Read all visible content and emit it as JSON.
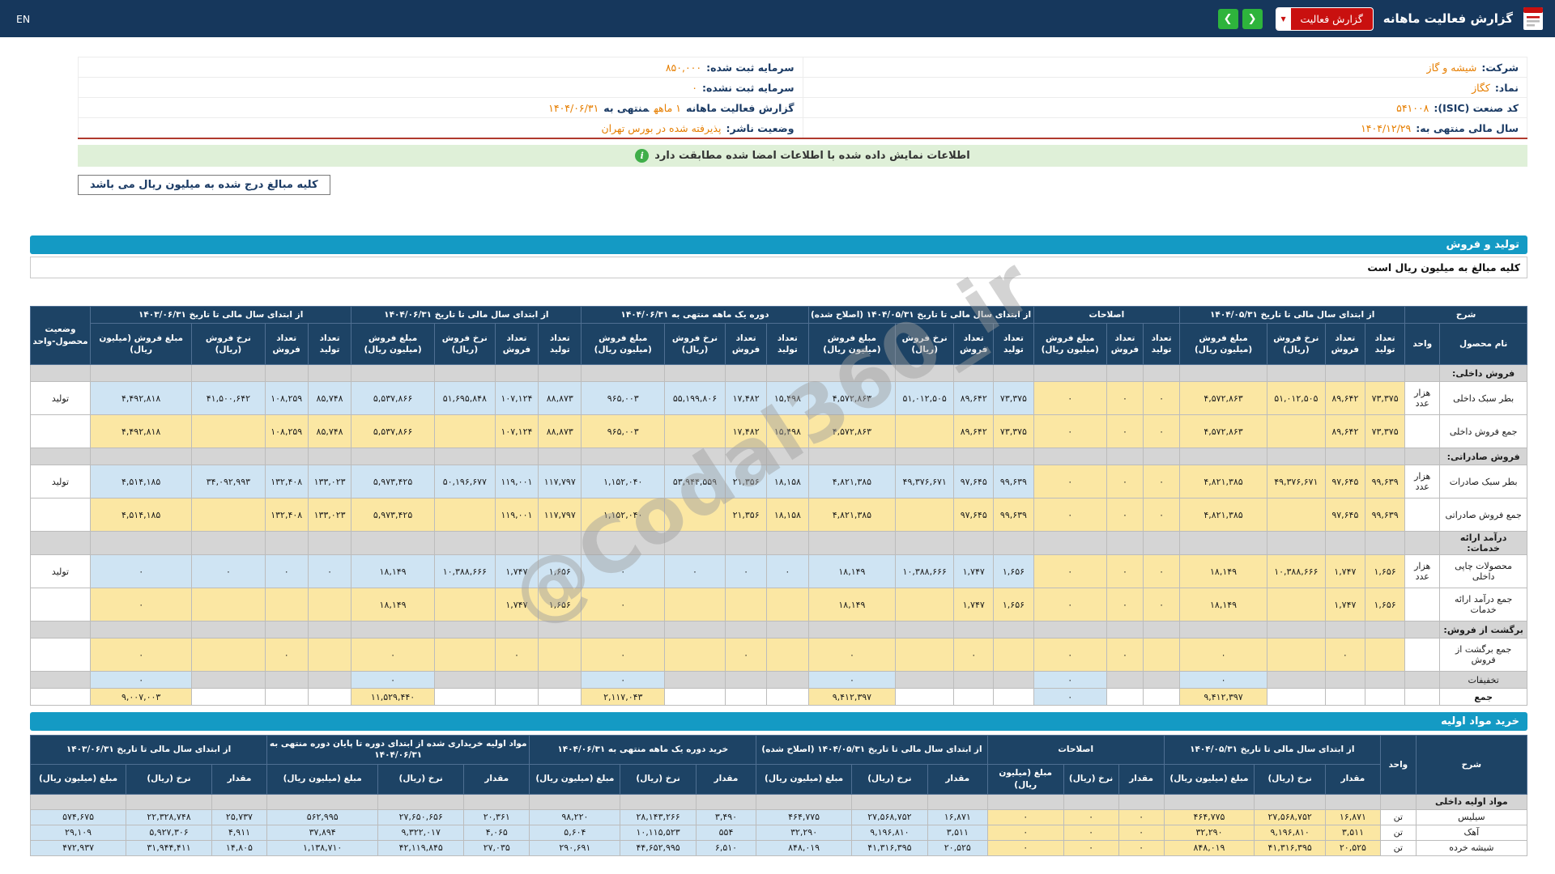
{
  "topbar": {
    "title": "گزارش فعالیت ماهانه",
    "report_button": "گزارش فعالیت",
    "caret": "▼",
    "nav_prev": "❮",
    "nav_next": "❯",
    "lang": "EN"
  },
  "info": {
    "rows": [
      {
        "r_label": "شرکت:",
        "r_value": "شیشه و گاز",
        "l_label": "سرمایه ثبت شده:",
        "l_value": "۸۵۰,۰۰۰"
      },
      {
        "r_label": "نماد:",
        "r_value": "کگاز",
        "l_label": "سرمایه ثبت نشده:",
        "l_value": "۰"
      },
      {
        "r_label": "کد صنعت (ISIC):",
        "r_value": "۵۴۱۰۰۸",
        "l_label": "گزارش فعالیت ماهانه",
        "l_value": "۱ ماهه",
        "l_mid": "منتهی به",
        "l_date": "۱۴۰۴/۰۶/۳۱"
      },
      {
        "r_label": "سال مالی منتهی به:",
        "r_value": "۱۴۰۴/۱۲/۲۹",
        "l_label": "وضعیت ناشر:",
        "l_value": "پذیرفته شده در بورس تهران"
      }
    ]
  },
  "alert": {
    "text": "اطلاعات نمایش داده شده با اطلاعات امضا شده مطابقت دارد",
    "icon_glyph": "i"
  },
  "note_box": "کلیه مبالغ درج شده به میلیون ریال می باشد",
  "watermark": "@Codal360_ir",
  "production_section": {
    "title": "تولید و فروش",
    "subtitle": "کلیه مبالغ به میلیون ریال است"
  },
  "production_table": {
    "desc_header": "شرح",
    "product_header": "نام محصول",
    "unit_header": "واحد",
    "status_header": "وضعیت محصول-واحد",
    "groups": [
      {
        "title": "از ابتدای سال مالی تا تاریخ ۱۴۰۴/۰۵/۳۱",
        "cols": [
          "تعداد تولید",
          "تعداد فروش",
          "نرخ فروش (ریال)",
          "مبلغ فروش (میلیون ریال)"
        ]
      },
      {
        "title": "اصلاحات",
        "cols": [
          "تعداد تولید",
          "تعداد فروش",
          "مبلغ فروش (میلیون ریال)"
        ]
      },
      {
        "title": "از ابتدای سال مالی تا تاریخ ۱۴۰۴/۰۵/۳۱ (اصلاح شده)",
        "cols": [
          "تعداد تولید",
          "تعداد فروش",
          "نرخ فروش (ریال)",
          "مبلغ فروش (میلیون ریال)"
        ]
      },
      {
        "title": "دوره یک ماهه منتهی به ۱۴۰۴/۰۶/۳۱",
        "cols": [
          "تعداد تولید",
          "تعداد فروش",
          "نرخ فروش (ریال)",
          "مبلغ فروش (میلیون ریال)"
        ]
      },
      {
        "title": "از ابتدای سال مالی تا تاریخ ۱۴۰۴/۰۶/۳۱",
        "cols": [
          "تعداد تولید",
          "تعداد فروش",
          "نرخ فروش (ریال)",
          "مبلغ فروش (میلیون ریال)"
        ]
      },
      {
        "title": "از ابتدای سال مالی تا تاریخ ۱۴۰۳/۰۶/۳۱",
        "cols": [
          "تعداد تولید",
          "تعداد فروش",
          "نرخ فروش (ریال)",
          "مبلغ فروش (میلیون ریال)"
        ]
      }
    ],
    "rows": [
      {
        "type": "section",
        "name": "فروش داخلی:"
      },
      {
        "type": "product",
        "name": "بطر سبک داخلی",
        "unit": "هزار عدد",
        "status": "تولید",
        "cells": [
          "۷۳,۳۷۵",
          "۸۹,۶۴۲",
          "۵۱,۰۱۲,۵۰۵",
          "۴,۵۷۲,۸۶۳",
          "۰",
          "۰",
          "۰",
          "۷۳,۳۷۵",
          "۸۹,۶۴۲",
          "۵۱,۰۱۲,۵۰۵",
          "۴,۵۷۲,۸۶۳",
          "۱۵,۴۹۸",
          "۱۷,۴۸۲",
          "۵۵,۱۹۹,۸۰۶",
          "۹۶۵,۰۰۳",
          "۸۸,۸۷۳",
          "۱۰۷,۱۲۴",
          "۵۱,۶۹۵,۸۴۸",
          "۵,۵۳۷,۸۶۶",
          "۸۵,۷۴۸",
          "۱۰۸,۲۵۹",
          "۴۱,۵۰۰,۶۴۲",
          "۴,۴۹۲,۸۱۸"
        ]
      },
      {
        "type": "sum",
        "name": "جمع فروش داخلی",
        "cells": [
          "۷۳,۳۷۵",
          "۸۹,۶۴۲",
          "",
          "۴,۵۷۲,۸۶۳",
          "۰",
          "۰",
          "۰",
          "۷۳,۳۷۵",
          "۸۹,۶۴۲",
          "",
          "۴,۵۷۲,۸۶۳",
          "۱۵,۴۹۸",
          "۱۷,۴۸۲",
          "",
          "۹۶۵,۰۰۳",
          "۸۸,۸۷۳",
          "۱۰۷,۱۲۴",
          "",
          "۵,۵۳۷,۸۶۶",
          "۸۵,۷۴۸",
          "۱۰۸,۲۵۹",
          "",
          "۴,۴۹۲,۸۱۸"
        ]
      },
      {
        "type": "section",
        "name": "فروش صادراتی:"
      },
      {
        "type": "product",
        "name": "بطر سبک صادرات",
        "unit": "هزار عدد",
        "status": "تولید",
        "cells": [
          "۹۹,۶۳۹",
          "۹۷,۶۴۵",
          "۴۹,۳۷۶,۶۷۱",
          "۴,۸۲۱,۳۸۵",
          "۰",
          "۰",
          "۰",
          "۹۹,۶۳۹",
          "۹۷,۶۴۵",
          "۴۹,۳۷۶,۶۷۱",
          "۴,۸۲۱,۳۸۵",
          "۱۸,۱۵۸",
          "۲۱,۳۵۶",
          "۵۳,۹۴۴,۵۵۹",
          "۱,۱۵۲,۰۴۰",
          "۱۱۷,۷۹۷",
          "۱۱۹,۰۰۱",
          "۵۰,۱۹۶,۶۷۷",
          "۵,۹۷۳,۴۲۵",
          "۱۳۳,۰۲۳",
          "۱۳۲,۴۰۸",
          "۳۴,۰۹۲,۹۹۳",
          "۴,۵۱۴,۱۸۵"
        ]
      },
      {
        "type": "sum",
        "name": "جمع فروش صادراتی",
        "cells": [
          "۹۹,۶۳۹",
          "۹۷,۶۴۵",
          "",
          "۴,۸۲۱,۳۸۵",
          "۰",
          "۰",
          "۰",
          "۹۹,۶۳۹",
          "۹۷,۶۴۵",
          "",
          "۴,۸۲۱,۳۸۵",
          "۱۸,۱۵۸",
          "۲۱,۳۵۶",
          "",
          "۱,۱۵۲,۰۴۰",
          "۱۱۷,۷۹۷",
          "۱۱۹,۰۰۱",
          "",
          "۵,۹۷۳,۴۲۵",
          "۱۳۳,۰۲۳",
          "۱۳۲,۴۰۸",
          "",
          "۴,۵۱۴,۱۸۵"
        ]
      },
      {
        "type": "section",
        "name": "درآمد ارائه خدمات:"
      },
      {
        "type": "product",
        "name": "محصولات چاپی داخلی",
        "unit": "هزار عدد",
        "status": "تولید",
        "cells": [
          "۱,۶۵۶",
          "۱,۷۴۷",
          "۱۰,۳۸۸,۶۶۶",
          "۱۸,۱۴۹",
          "۰",
          "۰",
          "۰",
          "۱,۶۵۶",
          "۱,۷۴۷",
          "۱۰,۳۸۸,۶۶۶",
          "۱۸,۱۴۹",
          "۰",
          "۰",
          "۰",
          "۰",
          "۱,۶۵۶",
          "۱,۷۴۷",
          "۱۰,۳۸۸,۶۶۶",
          "۱۸,۱۴۹",
          "۰",
          "۰",
          "۰",
          "۰"
        ]
      },
      {
        "type": "sum",
        "name": "جمع درآمد ارائه خدمات",
        "cells": [
          "۱,۶۵۶",
          "۱,۷۴۷",
          "",
          "۱۸,۱۴۹",
          "۰",
          "۰",
          "۰",
          "۱,۶۵۶",
          "۱,۷۴۷",
          "",
          "۱۸,۱۴۹",
          "",
          "",
          "",
          "۰",
          "۱,۶۵۶",
          "۱,۷۴۷",
          "",
          "۱۸,۱۴۹",
          "",
          "",
          "",
          "۰"
        ]
      },
      {
        "type": "section",
        "name": "برگشت از فروش:"
      },
      {
        "type": "sum",
        "name": "جمع برگشت از فروش",
        "cells": [
          "",
          "۰",
          "",
          "۰",
          "",
          "۰",
          "۰",
          "",
          "۰",
          "",
          "۰",
          "",
          "۰",
          "",
          "۰",
          "",
          "۰",
          "",
          "۰",
          "",
          "۰",
          "",
          "۰"
        ]
      },
      {
        "type": "disc",
        "name": "تخفیفات",
        "cells": [
          "",
          "",
          "",
          "۰",
          "",
          "",
          "۰",
          "",
          "",
          "",
          "۰",
          "",
          "",
          "",
          "۰",
          "",
          "",
          "",
          "۰",
          "",
          "",
          "",
          "۰"
        ]
      },
      {
        "type": "total",
        "name": "جمع",
        "cells": [
          "",
          "",
          "",
          "۹,۴۱۲,۳۹۷",
          "",
          "",
          "۰",
          "",
          "",
          "",
          "۹,۴۱۲,۳۹۷",
          "",
          "",
          "",
          "۲,۱۱۷,۰۴۳",
          "",
          "",
          "",
          "۱۱,۵۲۹,۴۴۰",
          "",
          "",
          "",
          "۹,۰۰۷,۰۰۳"
        ]
      }
    ]
  },
  "purchase_section": {
    "title": "خرید مواد اولیه"
  },
  "purchase_table": {
    "desc_header": "شرح",
    "unit_header": "واحد",
    "groups": [
      {
        "title": "از ابتدای سال مالی تا تاریخ ۱۴۰۴/۰۵/۳۱",
        "cols": [
          "مقدار",
          "نرخ (ریال)",
          "مبلغ (میلیون ریال)"
        ]
      },
      {
        "title": "اصلاحات",
        "cols": [
          "مقدار",
          "نرخ (ریال)",
          "مبلغ (میلیون ریال)"
        ]
      },
      {
        "title": "از ابتدای سال مالی تا تاریخ ۱۴۰۴/۰۵/۳۱ (اصلاح شده)",
        "cols": [
          "مقدار",
          "نرخ (ریال)",
          "مبلغ (میلیون ریال)"
        ]
      },
      {
        "title": "خرید دوره یک ماهه منتهی به ۱۴۰۴/۰۶/۳۱",
        "cols": [
          "مقدار",
          "نرخ (ریال)",
          "مبلغ (میلیون ریال)"
        ]
      },
      {
        "title": "مواد اولیه خریداری شده از ابتدای دوره تا پایان دوره منتهی به ۱۴۰۴/۰۶/۳۱",
        "cols": [
          "مقدار",
          "نرخ (ریال)",
          "مبلغ (میلیون ریال)"
        ]
      },
      {
        "title": "از ابتدای سال مالی تا تاریخ ۱۴۰۳/۰۶/۳۱",
        "cols": [
          "مقدار",
          "نرخ (ریال)",
          "مبلغ (میلیون ریال)"
        ]
      }
    ],
    "rows": [
      {
        "type": "section",
        "name": "مواد اولیه داخلی"
      },
      {
        "type": "product",
        "name": "سیلیس",
        "unit": "تن",
        "cells": [
          "۱۶,۸۷۱",
          "۲۷,۵۶۸,۷۵۲",
          "۴۶۴,۷۷۵",
          "۰",
          "۰",
          "۰",
          "۱۶,۸۷۱",
          "۲۷,۵۶۸,۷۵۲",
          "۴۶۴,۷۷۵",
          "۳,۴۹۰",
          "۲۸,۱۴۳,۲۶۶",
          "۹۸,۲۲۰",
          "۲۰,۳۶۱",
          "۲۷,۶۵۰,۶۵۶",
          "۵۶۲,۹۹۵",
          "۲۵,۷۳۷",
          "۲۲,۳۲۸,۷۴۸",
          "۵۷۴,۶۷۵"
        ]
      },
      {
        "type": "product",
        "name": "آهک",
        "unit": "تن",
        "cells": [
          "۳,۵۱۱",
          "۹,۱۹۶,۸۱۰",
          "۳۲,۲۹۰",
          "۰",
          "۰",
          "۰",
          "۳,۵۱۱",
          "۹,۱۹۶,۸۱۰",
          "۳۲,۲۹۰",
          "۵۵۴",
          "۱۰,۱۱۵,۵۲۳",
          "۵,۶۰۴",
          "۴,۰۶۵",
          "۹,۳۲۲,۰۱۷",
          "۳۷,۸۹۴",
          "۴,۹۱۱",
          "۵,۹۲۷,۳۰۶",
          "۲۹,۱۰۹"
        ]
      },
      {
        "type": "product",
        "name": "شیشه خرده",
        "unit": "تن",
        "cells": [
          "۲۰,۵۲۵",
          "۴۱,۳۱۶,۳۹۵",
          "۸۴۸,۰۱۹",
          "۰",
          "۰",
          "۰",
          "۲۰,۵۲۵",
          "۴۱,۳۱۶,۳۹۵",
          "۸۴۸,۰۱۹",
          "۶,۵۱۰",
          "۴۴,۶۵۲,۹۹۵",
          "۲۹۰,۶۹۱",
          "۲۷,۰۳۵",
          "۴۲,۱۱۹,۸۴۵",
          "۱,۱۳۸,۷۱۰",
          "۱۴,۸۰۵",
          "۳۱,۹۴۴,۴۱۱",
          "۴۷۲,۹۳۷"
        ]
      }
    ]
  }
}
